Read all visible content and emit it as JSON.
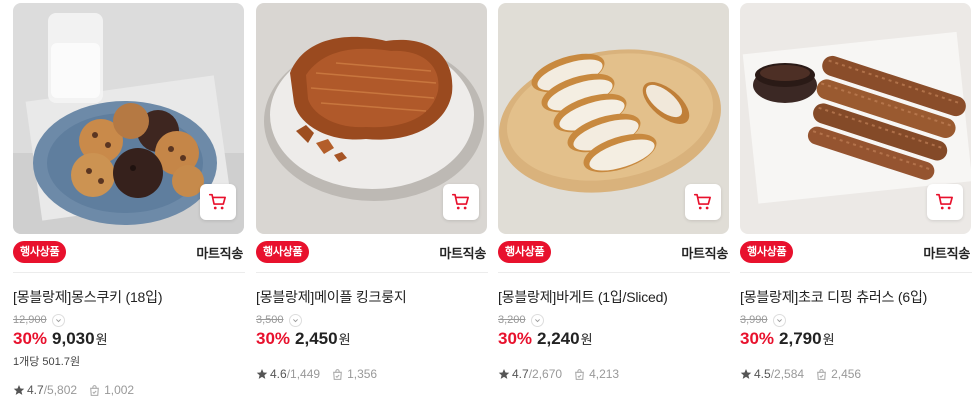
{
  "products": [
    {
      "badge": "행사상품",
      "shipping": "마트직송",
      "name": "[몽블랑제]몽스쿠키 (18입)",
      "original_price": "12,900",
      "discount_rate": "30%",
      "price": "9,030",
      "currency": "원",
      "unit_price": "1개당 501.7원",
      "rating": "4.7",
      "review_count": "5,802",
      "buyers": "1,002",
      "image": "cookies-plate"
    },
    {
      "badge": "행사상품",
      "shipping": "마트직송",
      "name": "[몽블랑제]메이플 킹크룽지",
      "original_price": "3,500",
      "discount_rate": "30%",
      "price": "2,450",
      "currency": "원",
      "unit_price": "",
      "rating": "4.6",
      "review_count": "1,449",
      "buyers": "1,356",
      "image": "maple-croissant-plate"
    },
    {
      "badge": "행사상품",
      "shipping": "마트직송",
      "name": "[몽블랑제]바게트 (1입/Sliced)",
      "original_price": "3,200",
      "discount_rate": "30%",
      "price": "2,240",
      "currency": "원",
      "unit_price": "",
      "rating": "4.7",
      "review_count": "2,670",
      "buyers": "4,213",
      "image": "sliced-baguette-board"
    },
    {
      "badge": "행사상품",
      "shipping": "마트직송",
      "name": "[몽블랑제]초코 디핑 츄러스 (6입)",
      "original_price": "3,990",
      "discount_rate": "30%",
      "price": "2,790",
      "currency": "원",
      "unit_price": "",
      "rating": "4.5",
      "review_count": "2,584",
      "buyers": "2,456",
      "image": "churros-choco-dip"
    }
  ],
  "colors": {
    "accent": "#e8112d",
    "text": "#222222",
    "muted": "#999999"
  },
  "icons": {
    "cart": "cart-icon",
    "star": "star-icon",
    "buyers": "shopping-bag-icon",
    "chevron": "chevron-down-icon"
  }
}
